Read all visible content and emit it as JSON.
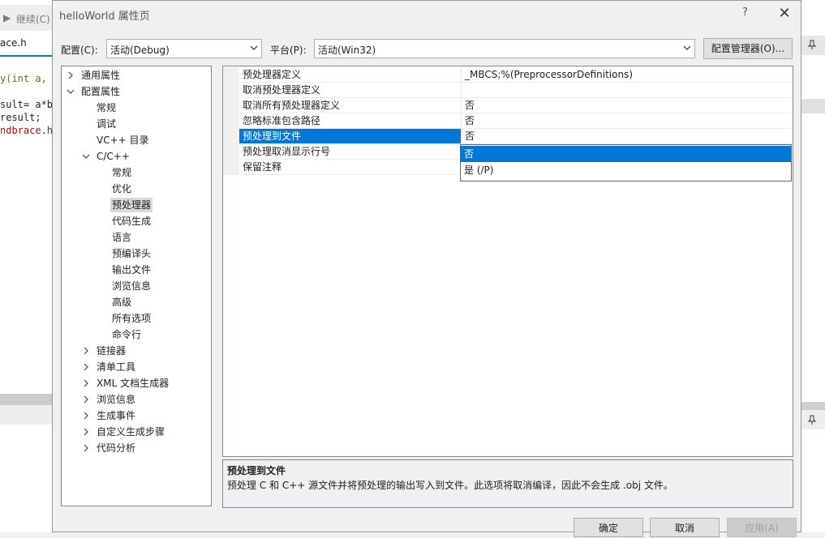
{
  "background": {
    "toolbar_continue": "继续(C)",
    "tab_file": "ace.h",
    "code_lines": [
      "y(int a,",
      "sult= a*b;",
      "result;",
      "ndbrace.h\""
    ]
  },
  "dialog": {
    "title": "helloWorld 属性页",
    "help": "?",
    "close": "✕"
  },
  "config": {
    "label": "配置(C):",
    "value": "活动(Debug)",
    "platform_label": "平台(P):",
    "platform_value": "活动(Win32)",
    "manager_button": "配置管理器(O)..."
  },
  "tree": {
    "items": [
      {
        "label": "通用属性",
        "expander": "collapsed"
      },
      {
        "label": "配置属性",
        "expander": "expanded"
      },
      {
        "label": "常规"
      },
      {
        "label": "调试"
      },
      {
        "label": "VC++ 目录"
      },
      {
        "label": "C/C++",
        "expander": "expanded"
      },
      {
        "label": "常规"
      },
      {
        "label": "优化"
      },
      {
        "label": "预处理器",
        "selected": true
      },
      {
        "label": "代码生成"
      },
      {
        "label": "语言"
      },
      {
        "label": "预编译头"
      },
      {
        "label": "输出文件"
      },
      {
        "label": "浏览信息"
      },
      {
        "label": "高级"
      },
      {
        "label": "所有选项"
      },
      {
        "label": "命令行"
      },
      {
        "label": "链接器",
        "expander": "collapsed"
      },
      {
        "label": "清单工具",
        "expander": "collapsed"
      },
      {
        "label": "XML 文档生成器",
        "expander": "collapsed"
      },
      {
        "label": "浏览信息",
        "expander": "collapsed"
      },
      {
        "label": "生成事件",
        "expander": "collapsed"
      },
      {
        "label": "自定义生成步骤",
        "expander": "collapsed"
      },
      {
        "label": "代码分析",
        "expander": "collapsed"
      }
    ]
  },
  "grid": {
    "rows": [
      {
        "name": "预处理器定义",
        "value": "_MBCS;%(PreprocessorDefinitions)"
      },
      {
        "name": "取消预处理器定义",
        "value": ""
      },
      {
        "name": "取消所有预处理器定义",
        "value": "否"
      },
      {
        "name": "忽略标准包含路径",
        "value": "否"
      },
      {
        "name": "预处理到文件",
        "value": "否",
        "active": true
      },
      {
        "name": "预处理取消显示行号",
        "value": ""
      },
      {
        "name": "保留注释",
        "value": ""
      }
    ],
    "dropdown_options": [
      {
        "label": "否",
        "highlighted": true
      },
      {
        "label": "是 (/P)"
      }
    ]
  },
  "description": {
    "title": "预处理到文件",
    "text": "预处理 C 和 C++ 源文件并将预处理的输出写入到文件。此选项将取消编译，因此不会生成 .obj 文件。"
  },
  "buttons": {
    "ok": "确定",
    "cancel": "取消",
    "apply": "应用(A)"
  },
  "colors": {
    "selection": "#0078d7",
    "dialog_bg": "#f0f0f0"
  }
}
